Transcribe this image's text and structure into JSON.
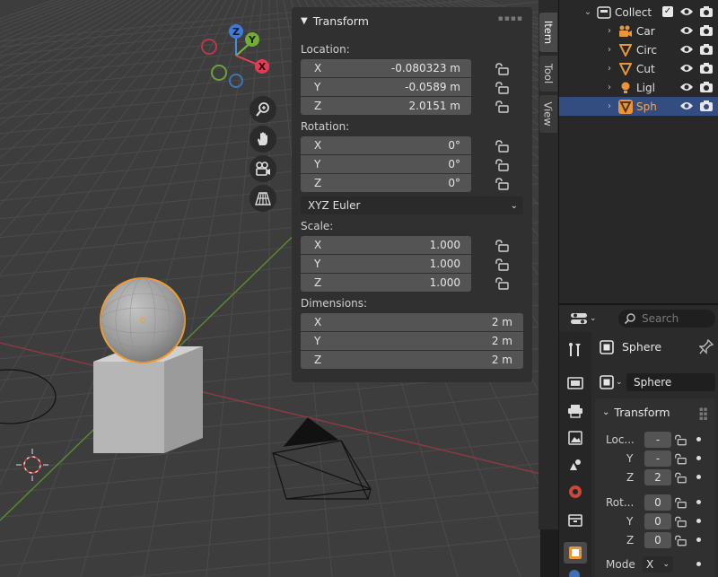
{
  "npanel": {
    "title": "Transform",
    "location": {
      "label": "Location:",
      "rows": [
        {
          "axis": "X",
          "value": "-0.080323 m"
        },
        {
          "axis": "Y",
          "value": "-0.0589 m"
        },
        {
          "axis": "Z",
          "value": "2.0151 m"
        }
      ]
    },
    "rotation": {
      "label": "Rotation:",
      "rows": [
        {
          "axis": "X",
          "value": "0°"
        },
        {
          "axis": "Y",
          "value": "0°"
        },
        {
          "axis": "Z",
          "value": "0°"
        }
      ]
    },
    "rotation_mode": "XYZ Euler",
    "scale": {
      "label": "Scale:",
      "rows": [
        {
          "axis": "X",
          "value": "1.000"
        },
        {
          "axis": "Y",
          "value": "1.000"
        },
        {
          "axis": "Z",
          "value": "1.000"
        }
      ]
    },
    "dimensions": {
      "label": "Dimensions:",
      "rows": [
        {
          "axis": "X",
          "value": "2 m"
        },
        {
          "axis": "Y",
          "value": "2 m"
        },
        {
          "axis": "Z",
          "value": "2 m"
        }
      ]
    }
  },
  "side_tabs": [
    "Item",
    "Tool",
    "View"
  ],
  "gizmo": {
    "z": "Z",
    "y": "Y",
    "x": "X"
  },
  "outliner": {
    "rows": [
      {
        "label": "Collect",
        "icon": "collection-icon"
      },
      {
        "label": "Car",
        "icon": "camera-icon"
      },
      {
        "label": "Circ",
        "icon": "mesh-icon"
      },
      {
        "label": "Cut",
        "icon": "mesh-icon"
      },
      {
        "label": "Ligl",
        "icon": "light-icon"
      },
      {
        "label": "Sph",
        "icon": "mesh-icon",
        "selected": true
      }
    ]
  },
  "properties": {
    "search_placeholder": "Search",
    "object_name": "Sphere",
    "data_name": "Sphere",
    "transform_title": "Transform",
    "location_label": "Loc...",
    "loc_x": "-",
    "loc_y_label": "Y",
    "loc_y": "-",
    "loc_z_label": "Z",
    "loc_z": "2",
    "rotation_label": "Rot...",
    "rot_x": "0",
    "rot_y_label": "Y",
    "rot_y": "0",
    "rot_z_label": "Z",
    "rot_z": "0",
    "mode_label": "Mode",
    "mode_value": "X"
  },
  "colors": {
    "viewport_bg": "#3d3d3d",
    "axis_x": "#e3435a",
    "axis_y": "#7ab73e",
    "axis_z": "#4a8ddd",
    "selection_outline": "#f09a32",
    "outliner_selected": "#334d80"
  }
}
